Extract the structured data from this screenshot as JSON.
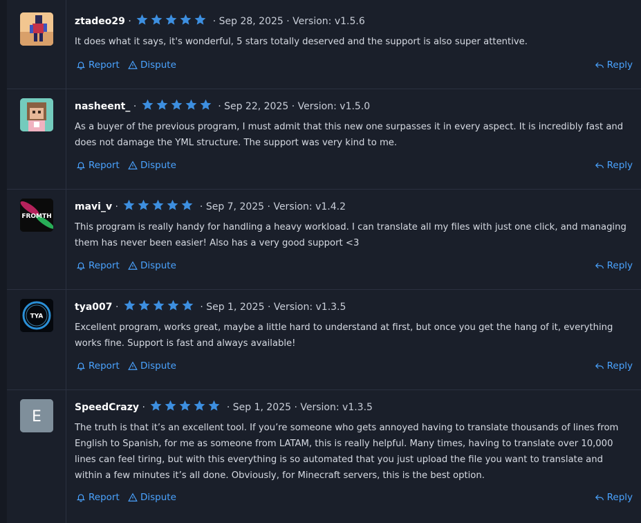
{
  "colors": {
    "accent": "#4aa3ff",
    "star": "#3d8fe0",
    "background": "#1a1f2a",
    "divider": "#2b3140"
  },
  "icons": {
    "report": "bell-icon",
    "dispute": "warning-triangle-icon",
    "reply": "reply-arrow-icon",
    "star": "star-icon"
  },
  "actions": {
    "report": "Report",
    "dispute": "Dispute",
    "reply": "Reply"
  },
  "reviews": [
    {
      "user": "ztadeo29",
      "rating": 5,
      "date": "Sep 28, 2025",
      "version": "Version: v1.5.6",
      "text": "It does what it says, it's wonderful, 5 stars totally deserved and the support is also super attentive."
    },
    {
      "user": "nasheent_",
      "rating": 5,
      "date": "Sep 22, 2025",
      "version": "Version: v1.5.0",
      "text": "As a buyer of the previous program, I must admit that this new one surpasses it in every aspect. It is incredibly fast and does not damage the YML structure. The support was very kind to me."
    },
    {
      "user": "mavi_v",
      "rating": 5,
      "date": "Sep 7, 2025",
      "version": "Version: v1.4.2",
      "avatar_text": "FROMTH",
      "text": "This program is really handy for handling a heavy workload. I can translate all my files with just one click, and managing them has never been easier! Also has a very good support <3"
    },
    {
      "user": "tya007",
      "rating": 5,
      "date": "Sep 1, 2025",
      "version": "Version: v1.3.5",
      "avatar_text": "TYA",
      "text": "Excellent program, works great, maybe a little hard to understand at first, but once you get the hang of it, everything works fine. Support is fast and always available!"
    },
    {
      "user": "SpeedCrazy",
      "rating": 5,
      "date": "Sep 1, 2025",
      "version": "Version: v1.3.5",
      "avatar_text": "E",
      "text": "The truth is that it’s an excellent tool. If you’re someone who gets annoyed having to translate thousands of lines from English to Spanish, for me as someone from LATAM, this is really helpful. Many times, having to translate over 10,000 lines can feel tiring, but with this everything is so automated that you just upload the file you want to translate and within a few minutes it’s all done. Obviously, for Minecraft servers, this is the best option."
    }
  ]
}
